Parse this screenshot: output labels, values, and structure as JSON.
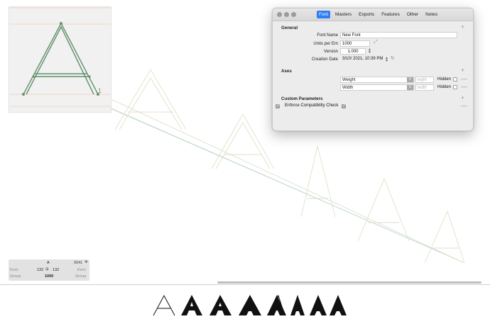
{
  "window": {
    "tabs": [
      {
        "label": "Font",
        "active": true
      },
      {
        "label": "Masters",
        "active": false
      },
      {
        "label": "Exports",
        "active": false
      },
      {
        "label": "Features",
        "active": false
      },
      {
        "label": "Other",
        "active": false
      },
      {
        "label": "Notes",
        "active": false
      }
    ],
    "general": {
      "title": "General",
      "font_name_label": "Font Name",
      "font_name_value": "New Font",
      "upm_label": "Units per Em",
      "upm_value": "1000",
      "version_label": "Version",
      "version_major": "1",
      "version_sep": ".",
      "version_minor": "000",
      "creation_label": "Creation Date",
      "creation_value": "3/10/ 2021, 10:39 PM"
    },
    "axes": {
      "title": "Axes",
      "rows": [
        {
          "name": "Weight",
          "tag_placeholder": "wght",
          "hidden_label": "Hidden"
        },
        {
          "name": "Width",
          "tag_placeholder": "wdth",
          "hidden_label": "Hidden"
        }
      ]
    },
    "custom": {
      "title": "Custom Parameters",
      "param_label": "Enforce Compatibility Check"
    }
  },
  "info_panel": {
    "glyph_name": "A",
    "unicode": "0041",
    "kern_label": "Kern",
    "lsb": "132",
    "rsb": "132",
    "group_label": "Group",
    "width": "1000"
  },
  "glyph_preview": {
    "master_index": "1"
  },
  "preview_text": [
    "A",
    "A",
    "A",
    "A",
    "A",
    "A",
    "A",
    "A"
  ],
  "colors": {
    "accent": "#2f7ef5",
    "outline": "#7a9a78",
    "guide": "#f0d7c8"
  }
}
